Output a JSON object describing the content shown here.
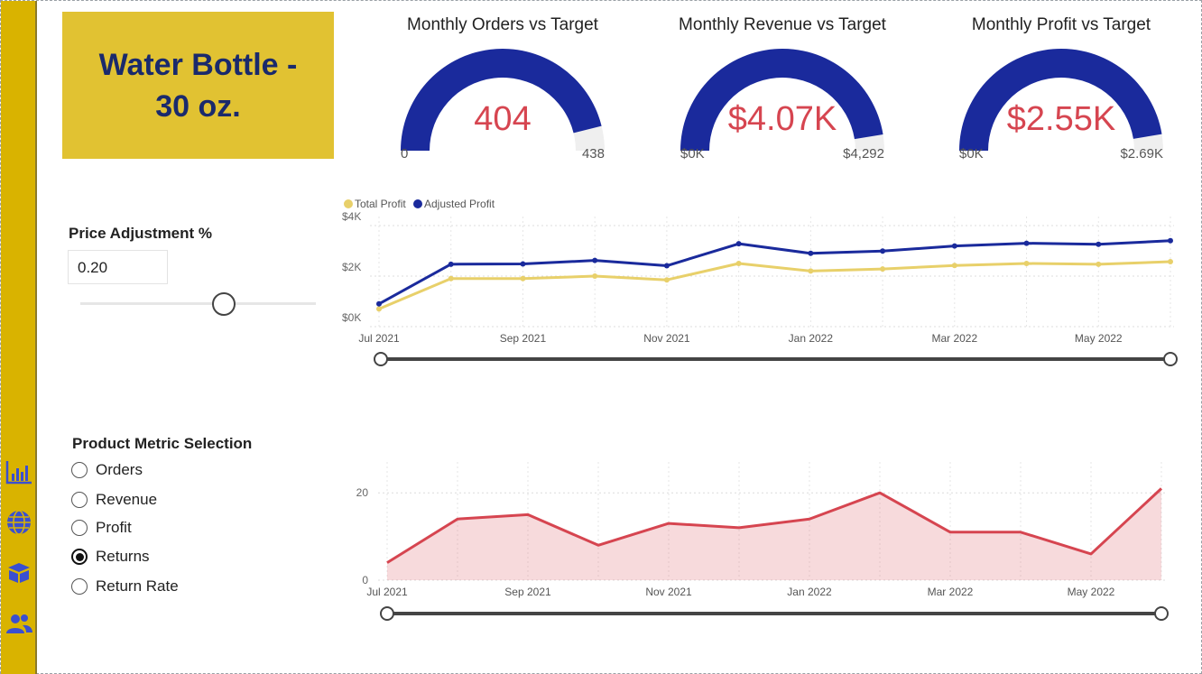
{
  "title": "Water Bottle - 30 oz.",
  "gauges": [
    {
      "title": "Monthly Orders vs Target",
      "value": "404",
      "min": "0",
      "max": "438",
      "fraction": 0.922
    },
    {
      "title": "Monthly Revenue vs Target",
      "value": "$4.07K",
      "min": "$0K",
      "max": "$4,292",
      "fraction": 0.949
    },
    {
      "title": "Monthly Profit vs Target",
      "value": "$2.55K",
      "min": "$0K",
      "max": "$2.69K",
      "fraction": 0.948
    }
  ],
  "price_adjustment": {
    "label": "Price Adjustment %",
    "value": "0.20",
    "slider_fraction": 0.6
  },
  "metric_selection": {
    "label": "Product Metric Selection",
    "options": [
      "Orders",
      "Revenue",
      "Profit",
      "Returns",
      "Return Rate"
    ],
    "selected": "Returns"
  },
  "colors": {
    "sidebar": "#d9b300",
    "title_bg": "#e1c232",
    "navy": "#1a2a9c",
    "red": "#d64550",
    "gold_line": "#e8d06a"
  },
  "sidebar_icons": [
    "bar-chart-icon",
    "globe-icon",
    "box-icon",
    "users-icon"
  ],
  "chart_data": [
    {
      "type": "line",
      "x": [
        "Jul 2021",
        "Aug 2021",
        "Sep 2021",
        "Oct 2021",
        "Nov 2021",
        "Dec 2021",
        "Jan 2022",
        "Feb 2022",
        "Mar 2022",
        "Apr 2022",
        "May 2022",
        "Jun 2022"
      ],
      "x_tick_labels": [
        "Jul 2021",
        "Sep 2021",
        "Nov 2021",
        "Jan 2022",
        "Mar 2022",
        "May 2022"
      ],
      "y_tick_labels": [
        "$0K",
        "$2K",
        "$4K"
      ],
      "ylim": [
        0,
        4000
      ],
      "legend": "top-left",
      "series": [
        {
          "name": "Total Profit",
          "color": "#e8d06a",
          "values": [
            700,
            1900,
            1900,
            2000,
            1850,
            2500,
            2200,
            2280,
            2420,
            2500,
            2470,
            2570
          ]
        },
        {
          "name": "Adjusted Profit",
          "color": "#1a2a9c",
          "values": [
            900,
            2470,
            2480,
            2620,
            2410,
            3280,
            2900,
            2990,
            3190,
            3300,
            3260,
            3400
          ]
        }
      ]
    },
    {
      "type": "area",
      "x": [
        "Jul 2021",
        "Aug 2021",
        "Sep 2021",
        "Oct 2021",
        "Nov 2021",
        "Dec 2021",
        "Jan 2022",
        "Feb 2022",
        "Mar 2022",
        "Apr 2022",
        "May 2022",
        "Jun 2022"
      ],
      "x_tick_labels": [
        "Jul 2021",
        "Sep 2021",
        "Nov 2021",
        "Jan 2022",
        "Mar 2022",
        "May 2022"
      ],
      "y_tick_labels": [
        "0",
        "20"
      ],
      "ylim": [
        0,
        25
      ],
      "series": [
        {
          "color": "#d64550",
          "values": [
            4,
            14,
            15,
            8,
            13,
            12,
            14,
            20,
            11,
            11,
            6,
            21
          ]
        }
      ]
    }
  ]
}
